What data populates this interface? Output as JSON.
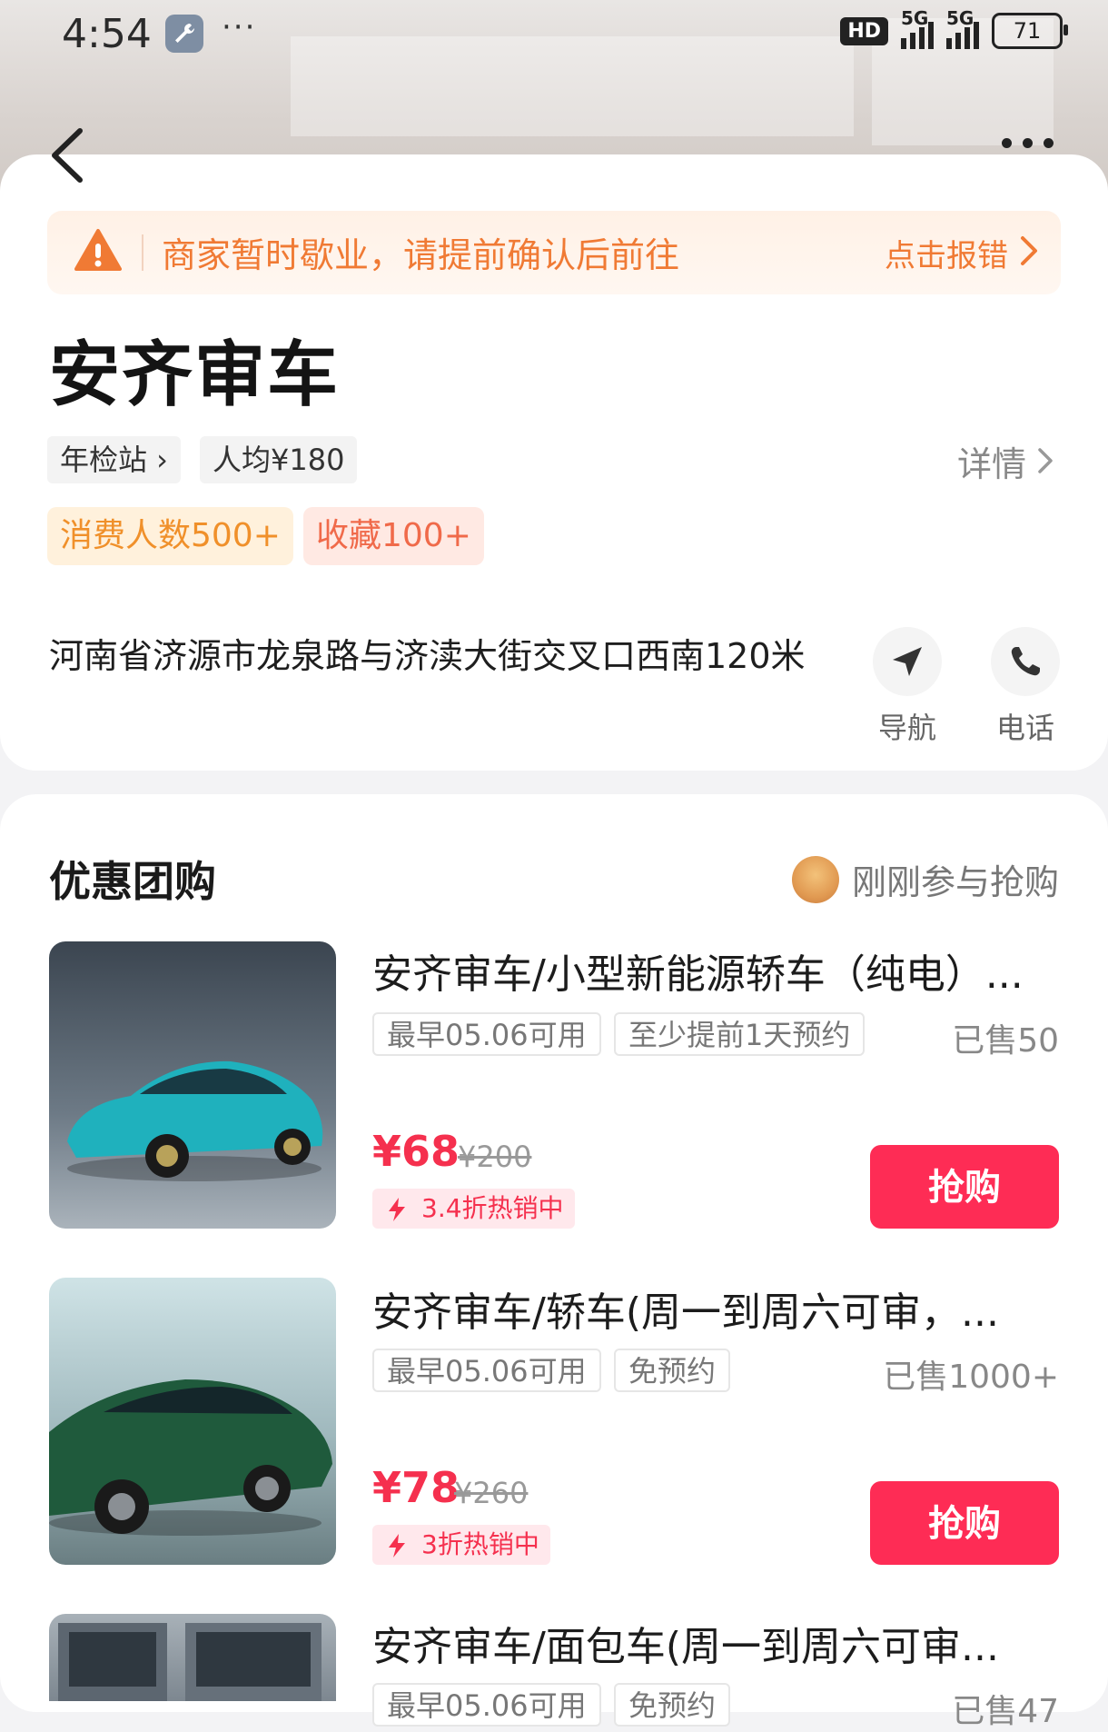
{
  "status_bar": {
    "time": "4:54",
    "more": "···",
    "hd": "HD",
    "net1": "5G",
    "net2": "5G",
    "battery": "71"
  },
  "notice": {
    "text": "商家暂时歇业，请提前确认后前往",
    "action": "点击报错"
  },
  "shop": {
    "name": "安齐审车",
    "category": "年检站 ›",
    "avg_price": "人均¥180",
    "details": "详情",
    "consumers": "消费人数500+",
    "favorites": "收藏100+",
    "address": "河南省济源市龙泉路与济渎大街交叉口西南120米",
    "nav_label": "导航",
    "phone_label": "电话"
  },
  "deals": {
    "title": "优惠团购",
    "joined_text": "刚刚参与抢购",
    "items": [
      {
        "title": "安齐审车/小型新能源轿车（纯电）...",
        "chip1": "最早05.06可用",
        "chip2": "至少提前1天预约",
        "sold": "已售50",
        "price": "¥68",
        "orig_price": "¥200",
        "badge": "3.4折热销中",
        "buy": "抢购",
        "car_color": "#1fb1bd"
      },
      {
        "title": "安齐审车/轿车(周一到周六可审，...",
        "chip1": "最早05.06可用",
        "chip2": "免预约",
        "sold": "已售1000+",
        "price": "¥78",
        "orig_price": "¥260",
        "badge": "3折热销中",
        "buy": "抢购",
        "car_color": "#1f5a3c"
      },
      {
        "title": "安齐审车/面包车(周一到周六可审...",
        "chip1": "最早05.06可用",
        "chip2": "免预约",
        "sold": "已售47"
      }
    ]
  },
  "colors": {
    "accent": "#fe2c55",
    "notice": "#f07a34"
  }
}
